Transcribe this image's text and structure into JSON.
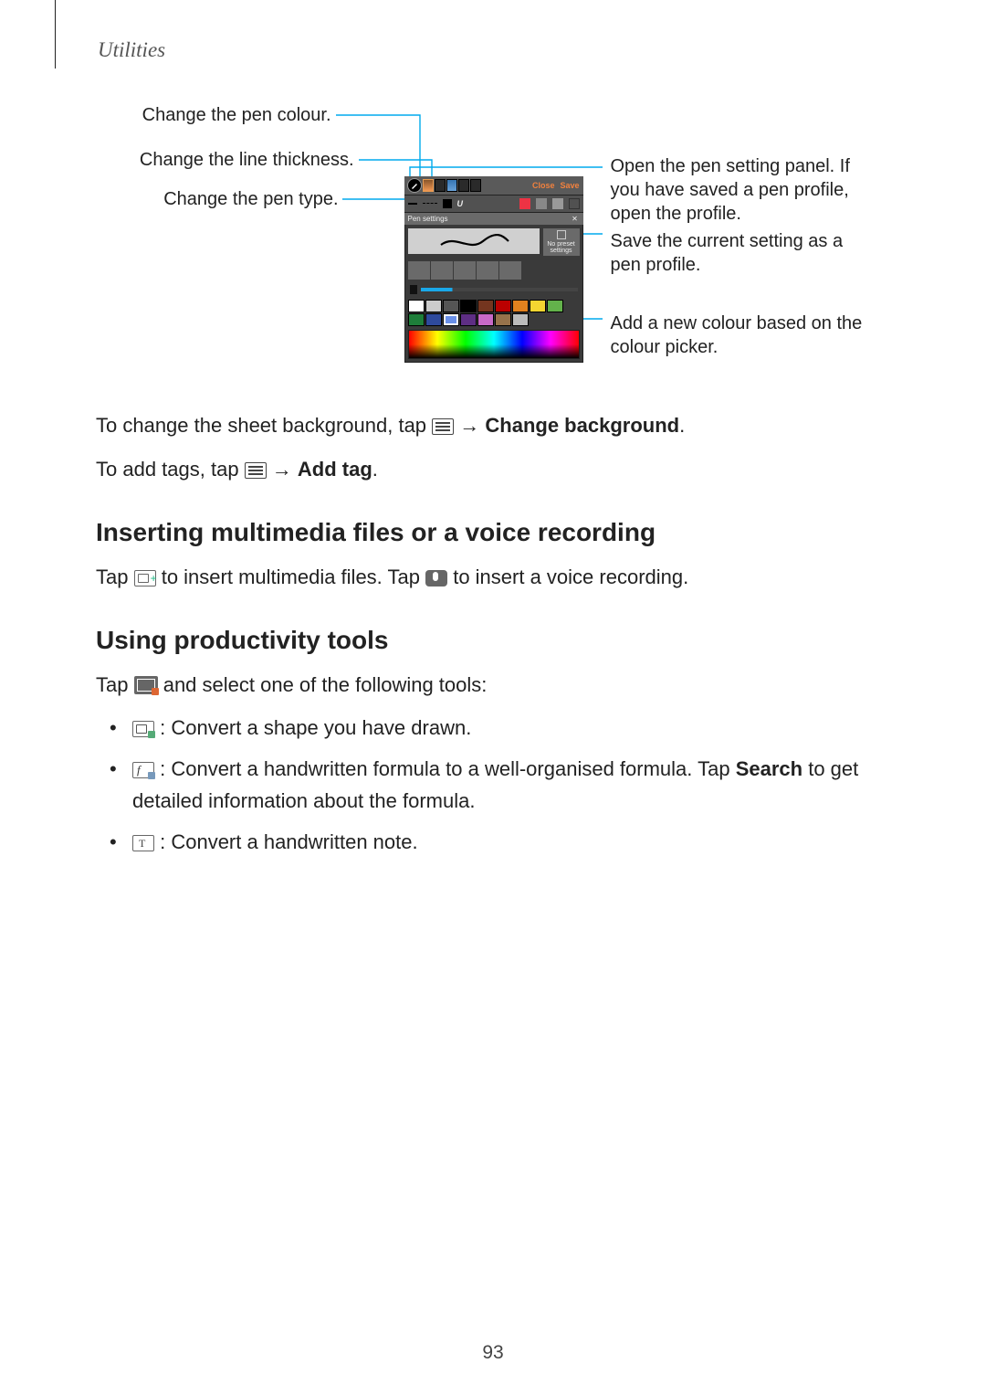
{
  "header": "Utilities",
  "page_number": "93",
  "callouts": {
    "left1": "Change the pen colour.",
    "left2": "Change the line thickness.",
    "left3": "Change the pen type.",
    "right1": "Open the pen setting panel. If you have saved a pen profile, open the profile.",
    "right2": "Save the current setting as a pen profile.",
    "right3": "Add a new colour based on the colour picker."
  },
  "panel": {
    "close": "Close",
    "save": "Save",
    "title": "Pen settings",
    "no_preset": "No preset settings"
  },
  "body": {
    "bg_pre": "To change the sheet background, tap ",
    "bg_post": " → ",
    "bg_bold": "Change background",
    "bg_end": ".",
    "tag_pre": "To add tags, tap ",
    "tag_post": " → ",
    "tag_bold": "Add tag",
    "tag_end": "."
  },
  "sec1": {
    "heading": "Inserting multimedia files or a voice recording",
    "p_pre": "Tap ",
    "p_mid": " to insert multimedia files. Tap ",
    "p_end": " to insert a voice recording."
  },
  "sec2": {
    "heading": "Using productivity tools",
    "p_pre": "Tap ",
    "p_post": " and select one of the following tools:",
    "item1": " : Convert a shape you have drawn.",
    "item2a": " : Convert a handwritten formula to a well-organised formula. Tap ",
    "item2_bold": "Search",
    "item2b": " to get detailed information about the formula.",
    "item3": " : Convert a handwritten note."
  }
}
